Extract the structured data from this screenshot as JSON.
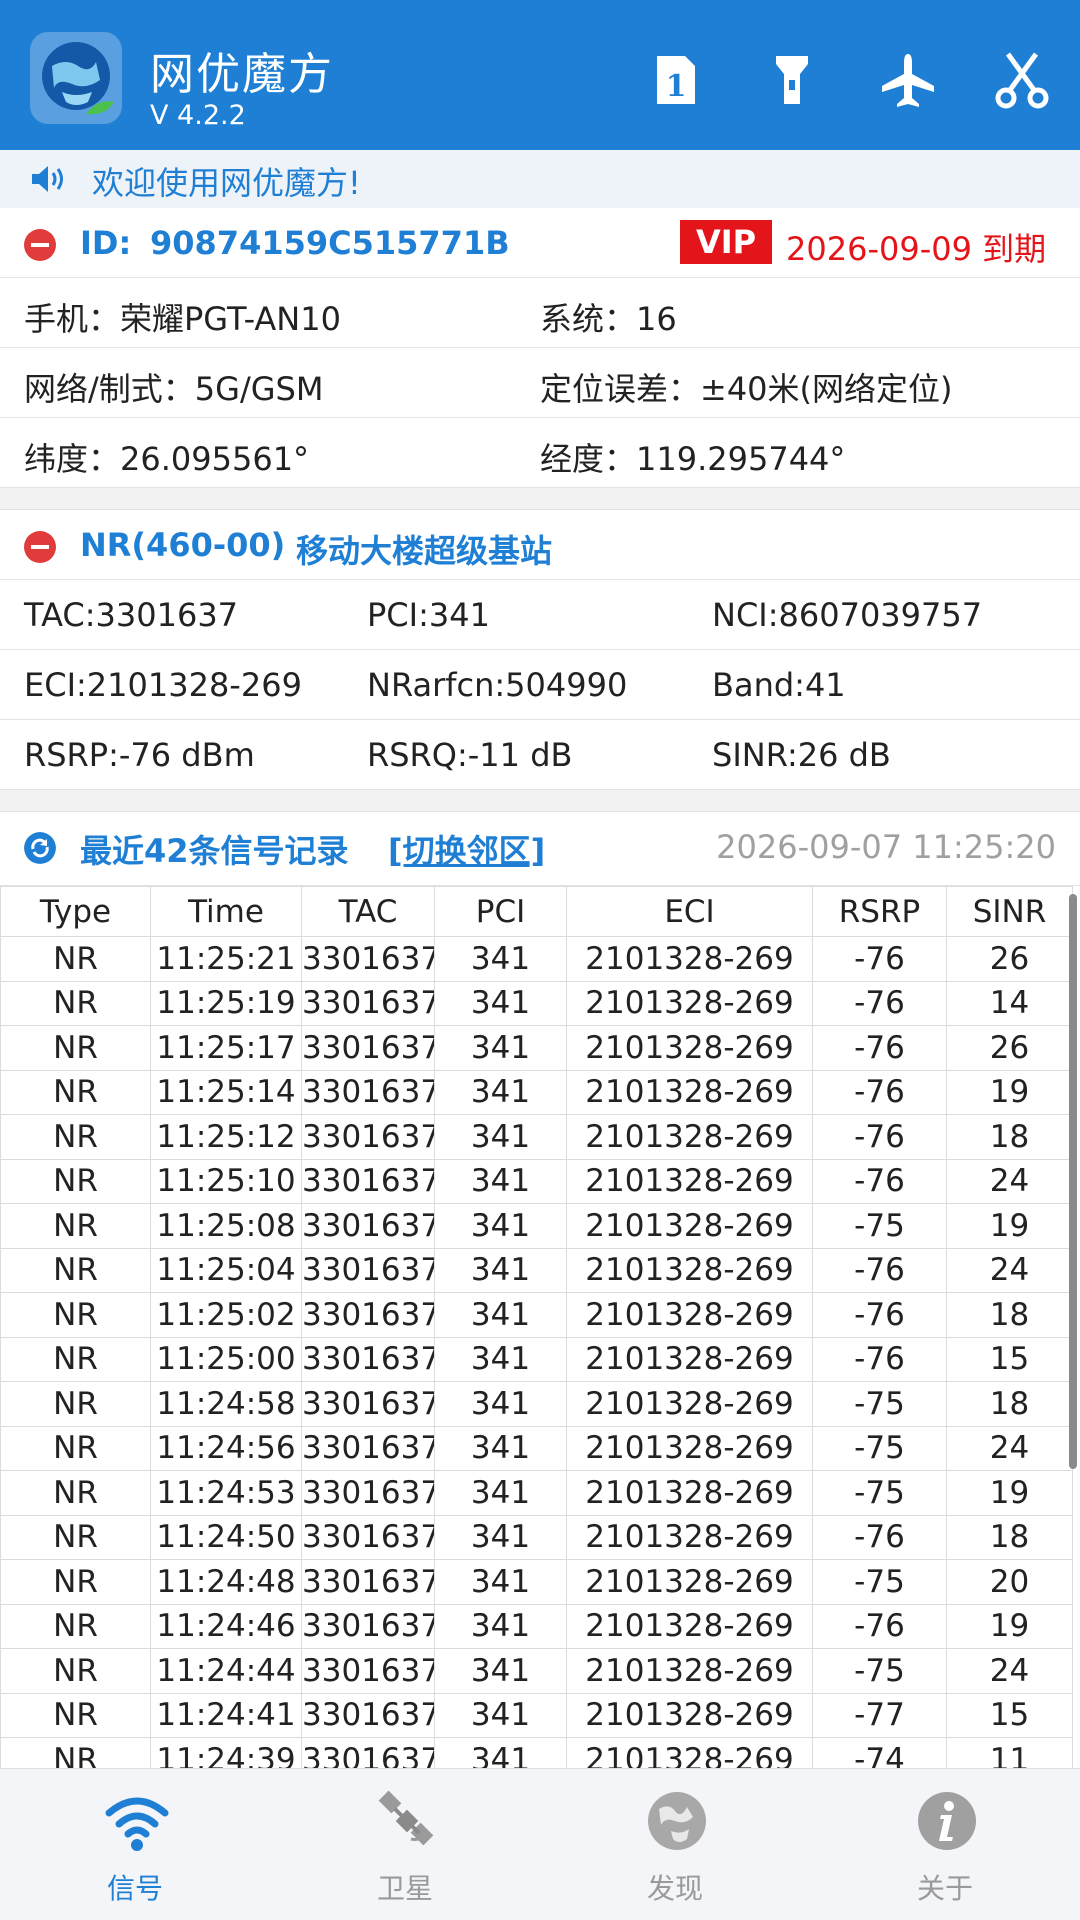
{
  "header": {
    "app_title": "网优魔方",
    "version": "V 4.2.2",
    "icons": [
      "sim-card-icon",
      "flashlight-icon",
      "airplane-icon",
      "scissors-icon"
    ],
    "sim_number": "1"
  },
  "welcome": {
    "text": "欢迎使用网优魔方!"
  },
  "device": {
    "id_label": "ID:",
    "id_value": "90874159C515771B",
    "vip": "VIP",
    "expire": "2026-09-09 到期",
    "phone": "手机：荣耀PGT-AN10",
    "system": "系统：16",
    "network": "网络/制式：5G/GSM",
    "location_error": "定位误差：±40米(网络定位)",
    "latitude": "纬度：26.095561°",
    "longitude": "经度：119.295744°"
  },
  "cell": {
    "title": "NR(460-00)",
    "name": "移动大楼超级基站",
    "tac": "TAC:3301637",
    "pci": "PCI:341",
    "nci": "NCI:8607039757",
    "eci": "ECI:2101328-269",
    "nrarfcn": "NRarfcn:504990",
    "band": "Band:41",
    "rsrp": "RSRP:-76 dBm",
    "rsrq": "RSRQ:-11 dB",
    "sinr": "SINR:26 dB"
  },
  "records": {
    "title": "最近42条信号记录",
    "switch_label": "[切换邻区]",
    "timestamp": "2026-09-07 11:25:20",
    "columns": [
      "Type",
      "Time",
      "TAC",
      "PCI",
      "ECI",
      "RSRP",
      "SINR"
    ],
    "rows": [
      [
        "NR",
        "11:25:21",
        "3301637",
        "341",
        "2101328-269",
        "-76",
        "26"
      ],
      [
        "NR",
        "11:25:19",
        "3301637",
        "341",
        "2101328-269",
        "-76",
        "14"
      ],
      [
        "NR",
        "11:25:17",
        "3301637",
        "341",
        "2101328-269",
        "-76",
        "26"
      ],
      [
        "NR",
        "11:25:14",
        "3301637",
        "341",
        "2101328-269",
        "-76",
        "19"
      ],
      [
        "NR",
        "11:25:12",
        "3301637",
        "341",
        "2101328-269",
        "-76",
        "18"
      ],
      [
        "NR",
        "11:25:10",
        "3301637",
        "341",
        "2101328-269",
        "-76",
        "24"
      ],
      [
        "NR",
        "11:25:08",
        "3301637",
        "341",
        "2101328-269",
        "-75",
        "19"
      ],
      [
        "NR",
        "11:25:04",
        "3301637",
        "341",
        "2101328-269",
        "-76",
        "24"
      ],
      [
        "NR",
        "11:25:02",
        "3301637",
        "341",
        "2101328-269",
        "-76",
        "18"
      ],
      [
        "NR",
        "11:25:00",
        "3301637",
        "341",
        "2101328-269",
        "-76",
        "15"
      ],
      [
        "NR",
        "11:24:58",
        "3301637",
        "341",
        "2101328-269",
        "-75",
        "18"
      ],
      [
        "NR",
        "11:24:56",
        "3301637",
        "341",
        "2101328-269",
        "-75",
        "24"
      ],
      [
        "NR",
        "11:24:53",
        "3301637",
        "341",
        "2101328-269",
        "-75",
        "19"
      ],
      [
        "NR",
        "11:24:50",
        "3301637",
        "341",
        "2101328-269",
        "-76",
        "18"
      ],
      [
        "NR",
        "11:24:48",
        "3301637",
        "341",
        "2101328-269",
        "-75",
        "20"
      ],
      [
        "NR",
        "11:24:46",
        "3301637",
        "341",
        "2101328-269",
        "-76",
        "19"
      ],
      [
        "NR",
        "11:24:44",
        "3301637",
        "341",
        "2101328-269",
        "-75",
        "24"
      ],
      [
        "NR",
        "11:24:41",
        "3301637",
        "341",
        "2101328-269",
        "-77",
        "15"
      ],
      [
        "NR",
        "11:24:39",
        "3301637",
        "341",
        "2101328-269",
        "-74",
        "11"
      ]
    ]
  },
  "nav": {
    "items": [
      {
        "label": "信号",
        "icon": "wifi-signal-icon"
      },
      {
        "label": "卫星",
        "icon": "satellite-icon"
      },
      {
        "label": "发现",
        "icon": "globe-icon"
      },
      {
        "label": "关于",
        "icon": "info-icon"
      }
    ],
    "active": "信号"
  },
  "colors": {
    "primary": "#1f7fd4",
    "danger": "#e3151a",
    "muted": "#9a9a9a"
  }
}
